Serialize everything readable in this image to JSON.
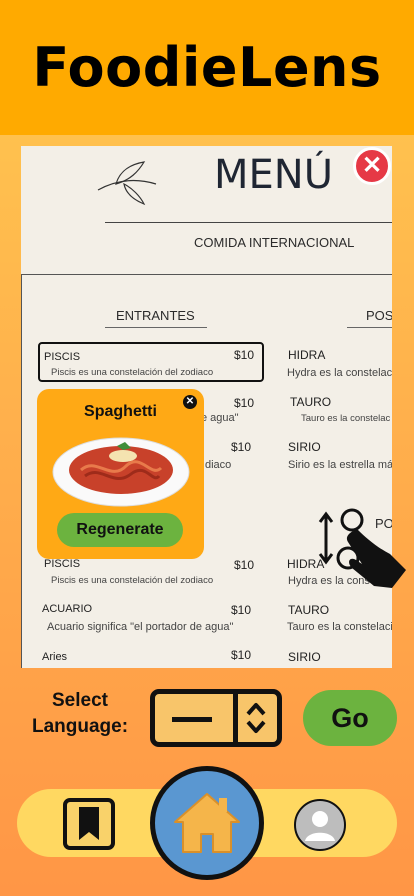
{
  "app": {
    "title": "FoodieLens"
  },
  "menu": {
    "title": "MENÚ",
    "subtitle": "COMIDA INTERNACIONAL",
    "section_left": "ENTRANTES",
    "section_right": "POS",
    "section_right_2": "PO",
    "left_items": [
      {
        "name": "PISCIS",
        "price": "$10",
        "desc": "Piscis es una constelación del zodiaco"
      },
      {
        "price": "$10",
        "desc": "e agua\""
      },
      {
        "price": "$10",
        "desc": "diaco"
      },
      {
        "name": "PISCIS",
        "price": "$10",
        "desc": "Piscis es una constelación del zodiaco"
      },
      {
        "name": "ACUARIO",
        "price": "$10",
        "desc": "Acuario significa \"el portador de agua\""
      },
      {
        "name": "Aries",
        "price": "$10"
      }
    ],
    "right_items": [
      {
        "name": "HIDRA",
        "desc": "Hydra es la constelac"
      },
      {
        "name": "TAURO",
        "desc": "Tauro es la constelac"
      },
      {
        "name": "SIRIO",
        "desc": "Sirio es la estrella más"
      },
      {
        "name": "HIDRA",
        "desc": "Hydra es la cons"
      },
      {
        "name": "TAURO",
        "desc": "Tauro es la constelació"
      },
      {
        "name": "SIRIO"
      }
    ]
  },
  "popup": {
    "title": "Spaghetti",
    "regenerate_label": "Regenerate"
  },
  "language": {
    "label_line1": "Select",
    "label_line2": "Language:"
  },
  "go_label": "Go",
  "colors": {
    "accent": "#ffaa00",
    "button_green": "#6cb33f",
    "home_blue": "#5a97d1",
    "close_red": "#e63946"
  },
  "icons": [
    "close-icon",
    "leaf-icon",
    "pinch-gesture-icon",
    "stepper-icon",
    "bookmark-icon",
    "home-icon",
    "profile-icon"
  ]
}
